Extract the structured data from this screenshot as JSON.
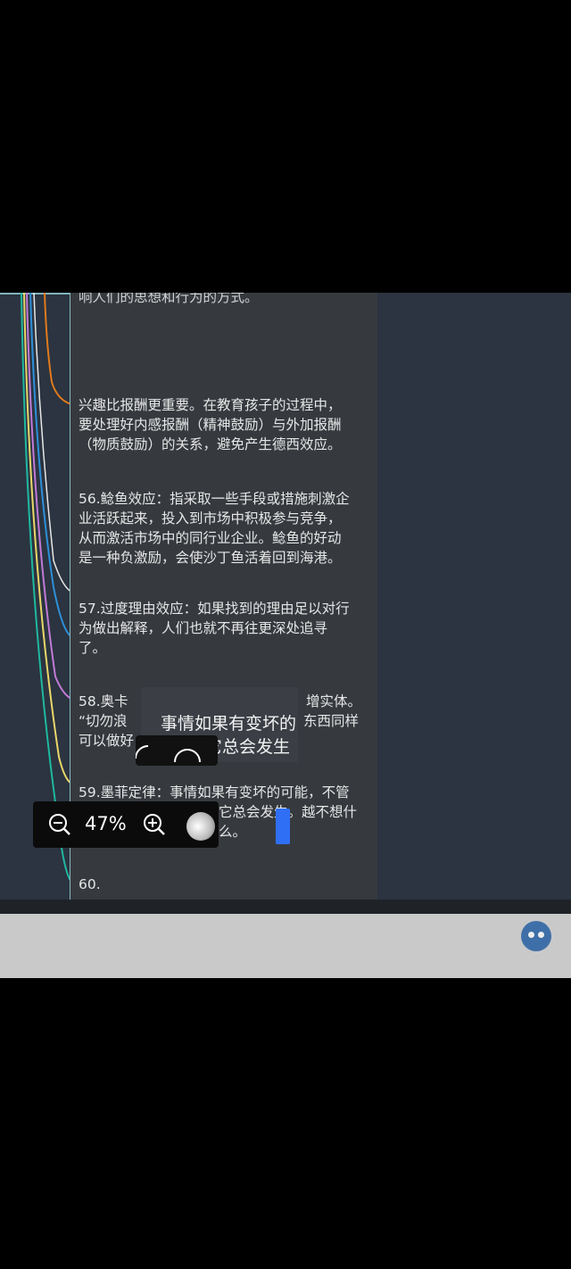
{
  "document": {
    "line_partial": "响人们的思想和行为的方式。",
    "para_interest": "兴趣比报酬更重要。在教育孩子的过程中，\n要处理好内感报酬（精神鼓励）与外加报酬\n（物质鼓励）的关系，避免产生德西效应。",
    "para_56": "56.鲶鱼效应：指采取一些手段或措施刺激企\n业活跃起来，投入到市场中积极参与竞争，\n从而激活市场中的同行业企业。鲶鱼的好动\n是一种负激励，会使沙丁鱼活着回到海港。",
    "para_57": "57.过度理由效应：如果找到的理由足以对行\n为做出解释，人们也就不再往更深处追寻\n了。",
    "para_58_a": "58.奥卡",
    "para_58_b": "增实体。",
    "para_58_c": "“切勿浪",
    "para_58_d": "东西同样",
    "para_58_e": "可以做好",
    "para_59": "59.墨菲定律：事情如果有变坏的可能，不管",
    "para_59_b": "它总会发生。越不想什",
    "para_59_c": "么。",
    "para_60": "60."
  },
  "tooltip": {
    "line1": "事情如果有变坏的",
    "line2": "它总会发生"
  },
  "zoom": {
    "percent_label": "47%",
    "zoom_out_icon": "zoom-out-icon",
    "zoom_in_icon": "zoom-in-icon"
  },
  "colors": {
    "canvas": "#2b3440",
    "doc_bg": "#363a3f",
    "accent_border": "#8ab8c0",
    "cursor_blue": "#2f6ff5"
  }
}
